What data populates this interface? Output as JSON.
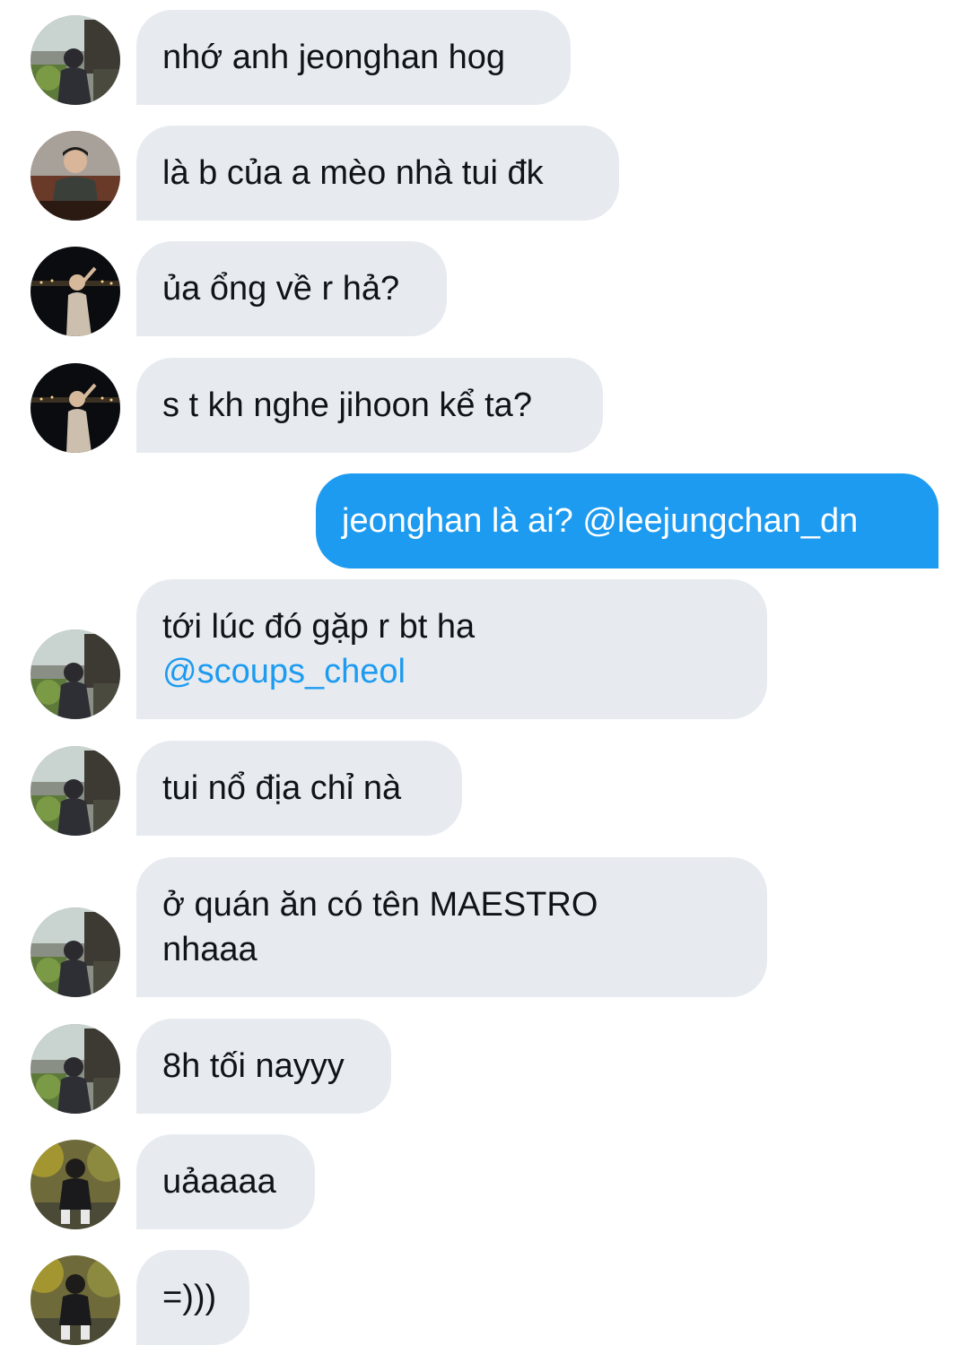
{
  "messages": [
    {
      "text": "nhớ anh jeonghan hog"
    },
    {
      "text": "là b của a mèo nhà tui đk"
    },
    {
      "text": "ủa ổng về r hả?"
    },
    {
      "text": "s t kh nghe jihoon kể ta?"
    },
    {
      "text": "jeonghan là ai? @leejungchan_dn"
    },
    {
      "text": "tới lúc đó gặp r bt ha",
      "mention": "@scoups_cheol"
    },
    {
      "text": "tui nổ địa chỉ nà"
    },
    {
      "line1": "ở quán ăn có tên MAESTRO",
      "line2": "nhaaa"
    },
    {
      "text": "8h tối nayyy"
    },
    {
      "text": "uảaaaa"
    },
    {
      "text": "=)))"
    }
  ],
  "colors": {
    "incoming_bubble": "#e7ebf0",
    "outgoing_bubble": "#1d9bf0",
    "mention": "#1d9bf0",
    "text": "#0f1419"
  },
  "avatars": {
    "a": "avatar-man-in-garden-photo",
    "b": "avatar-man-with-dark-background-photo",
    "c": "avatar-night-city-photo",
    "d": "avatar-sitting-person-greenery-photo"
  }
}
